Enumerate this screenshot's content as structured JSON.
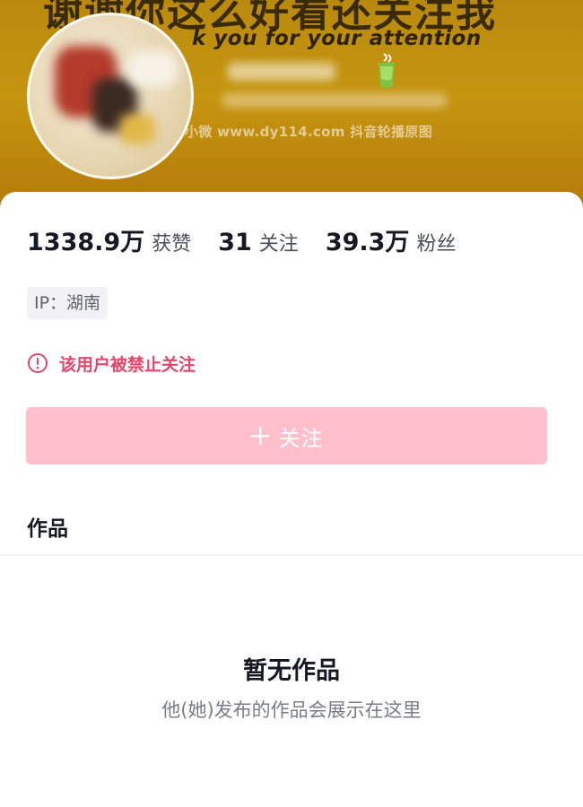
{
  "banner": {
    "headline": "谢谢你这么好看还关注我",
    "tagline": "k you for your attention",
    "watermark": "小微 www.dy114.com 抖音轮播原图"
  },
  "profile": {
    "stats": [
      {
        "value": "1338.9万",
        "label": "获赞"
      },
      {
        "value": "31",
        "label": "关注"
      },
      {
        "value": "39.3万",
        "label": "粉丝"
      }
    ],
    "ip_label": "IP：湖南",
    "banned_notice": "该用户被禁止关注",
    "follow_label": "关注"
  },
  "tabs": {
    "works": "作品"
  },
  "empty_state": {
    "title": "暂无作品",
    "subtitle": "他(她)发布的作品会展示在这里"
  },
  "colors": {
    "banner": "#c6950f",
    "warning": "#e4456a",
    "follow_button": "#ffbfcb"
  },
  "icons": {
    "warning": "warning-circle-icon",
    "plus": "plus-icon",
    "cup": "cup-icon"
  }
}
